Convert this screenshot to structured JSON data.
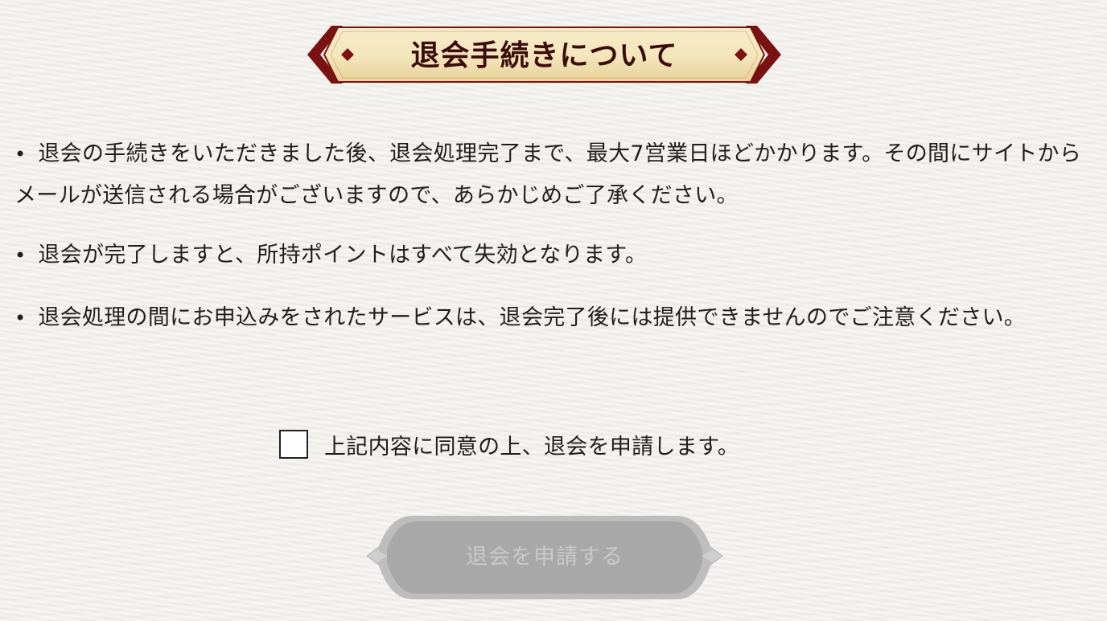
{
  "header": {
    "title": "退会手続きについて"
  },
  "notices": [
    {
      "bullet": "•",
      "text": "退会の手続きをいただきました後、退会処理完了まで、最大7営業日ほどかかります。その間にサイトからメールが送信される場合がございますので、あらかじめご了承ください。"
    },
    {
      "bullet": "•",
      "text": "退会が完了しますと、所持ポイントはすべて失効となります。"
    },
    {
      "bullet": "•",
      "text": "退会処理の間にお申込みをされたサービスは、退会完了後には提供できませんのでご注意ください。"
    }
  ],
  "agreement": {
    "checked": false,
    "label": "上記内容に同意の上、退会を申請します。"
  },
  "submit": {
    "label": "退会を申請する",
    "disabled": true
  },
  "colors": {
    "banner_accent": "#7a1212",
    "banner_fill": "#f3e4b8",
    "title_text": "#3b0c0c",
    "body_text": "#1e1e1e",
    "disabled_button": "#a6a6a6",
    "disabled_text": "#c9c9c9",
    "background": "#f1efeb"
  }
}
